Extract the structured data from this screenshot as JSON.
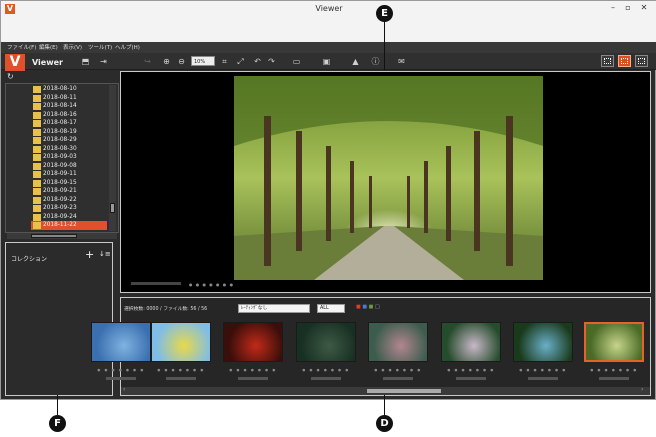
{
  "window": {
    "title": "Viewer",
    "logo_letter": "V",
    "minimize": "–",
    "restore": "▫",
    "close": "✕"
  },
  "menu": [
    "ファイル(F)",
    "編集(E)",
    "表示(V)",
    "ツール(T)",
    "ヘルプ(H)"
  ],
  "toolbar": {
    "brand_letter": "V",
    "brand_label": "Viewer",
    "zoom_value": "10%",
    "icons": [
      "folder-icon",
      "export-icon",
      "rotate-icon",
      "zoom-in-icon",
      "zoom-out-icon",
      "fit-icon",
      "fullscreen-icon",
      "rotate-left-icon",
      "rotate-right-icon",
      "compare-icon",
      "slideshow-icon",
      "image-icon",
      "info-icon",
      "mail-icon"
    ],
    "view_modes": [
      "grid-view",
      "preview-view",
      "dual-view"
    ]
  },
  "tree": {
    "sync_icon": "↻",
    "folders": [
      "2018-08-10",
      "2018-08-11",
      "2018-08-14",
      "2018-08-16",
      "2018-08-17",
      "2018-08-19",
      "2018-08-29",
      "2018-08-30",
      "2018-09-03",
      "2018-09-08",
      "2018-09-11",
      "2018-09-15",
      "2018-09-21",
      "2018-09-22",
      "2018-09-23",
      "2018-09-24",
      "2018-11-22"
    ],
    "selected": "2018-11-22"
  },
  "collection": {
    "title": "コレクション",
    "add": "+",
    "sort": "↓≡"
  },
  "filmstrip": {
    "status": "選択枚数: 0000 / ファイル数: 56 / 56",
    "filter1": "ﾚｰﾃｨﾝｸﾞなし",
    "filter2": "ALL",
    "meta_dots": "● ● ● ● ●  ● ●",
    "thumbnails": [
      {
        "name": "partial-thumb",
        "colors": [
          "#3a6fb0",
          "#7fb3e0"
        ]
      },
      {
        "name": "dandelion",
        "colors": [
          "#7fbde6",
          "#e8d94a"
        ]
      },
      {
        "name": "red-spider-lily",
        "colors": [
          "#3a0e0b",
          "#c22a18"
        ]
      },
      {
        "name": "dark-flower",
        "colors": [
          "#183024",
          "#3e5a44"
        ]
      },
      {
        "name": "pink-flower",
        "colors": [
          "#3c5c4d",
          "#b2878f"
        ]
      },
      {
        "name": "cosmos-field",
        "colors": [
          "#254c2c",
          "#c9b8c9"
        ]
      },
      {
        "name": "blue-flower",
        "colors": [
          "#1a3a1c",
          "#6ab0c8"
        ]
      },
      {
        "name": "tree-avenue",
        "colors": [
          "#4a6a26",
          "#c7d58a"
        ]
      }
    ],
    "selected_index": 7,
    "left_arrow": "‹",
    "right_arrow": "›"
  },
  "callouts": {
    "main_view": "E",
    "filmstrip": "D",
    "collection": "F"
  },
  "colors": {
    "accent": "#e0502a",
    "selection": "#e6622a",
    "folder": "#e8c14c"
  }
}
